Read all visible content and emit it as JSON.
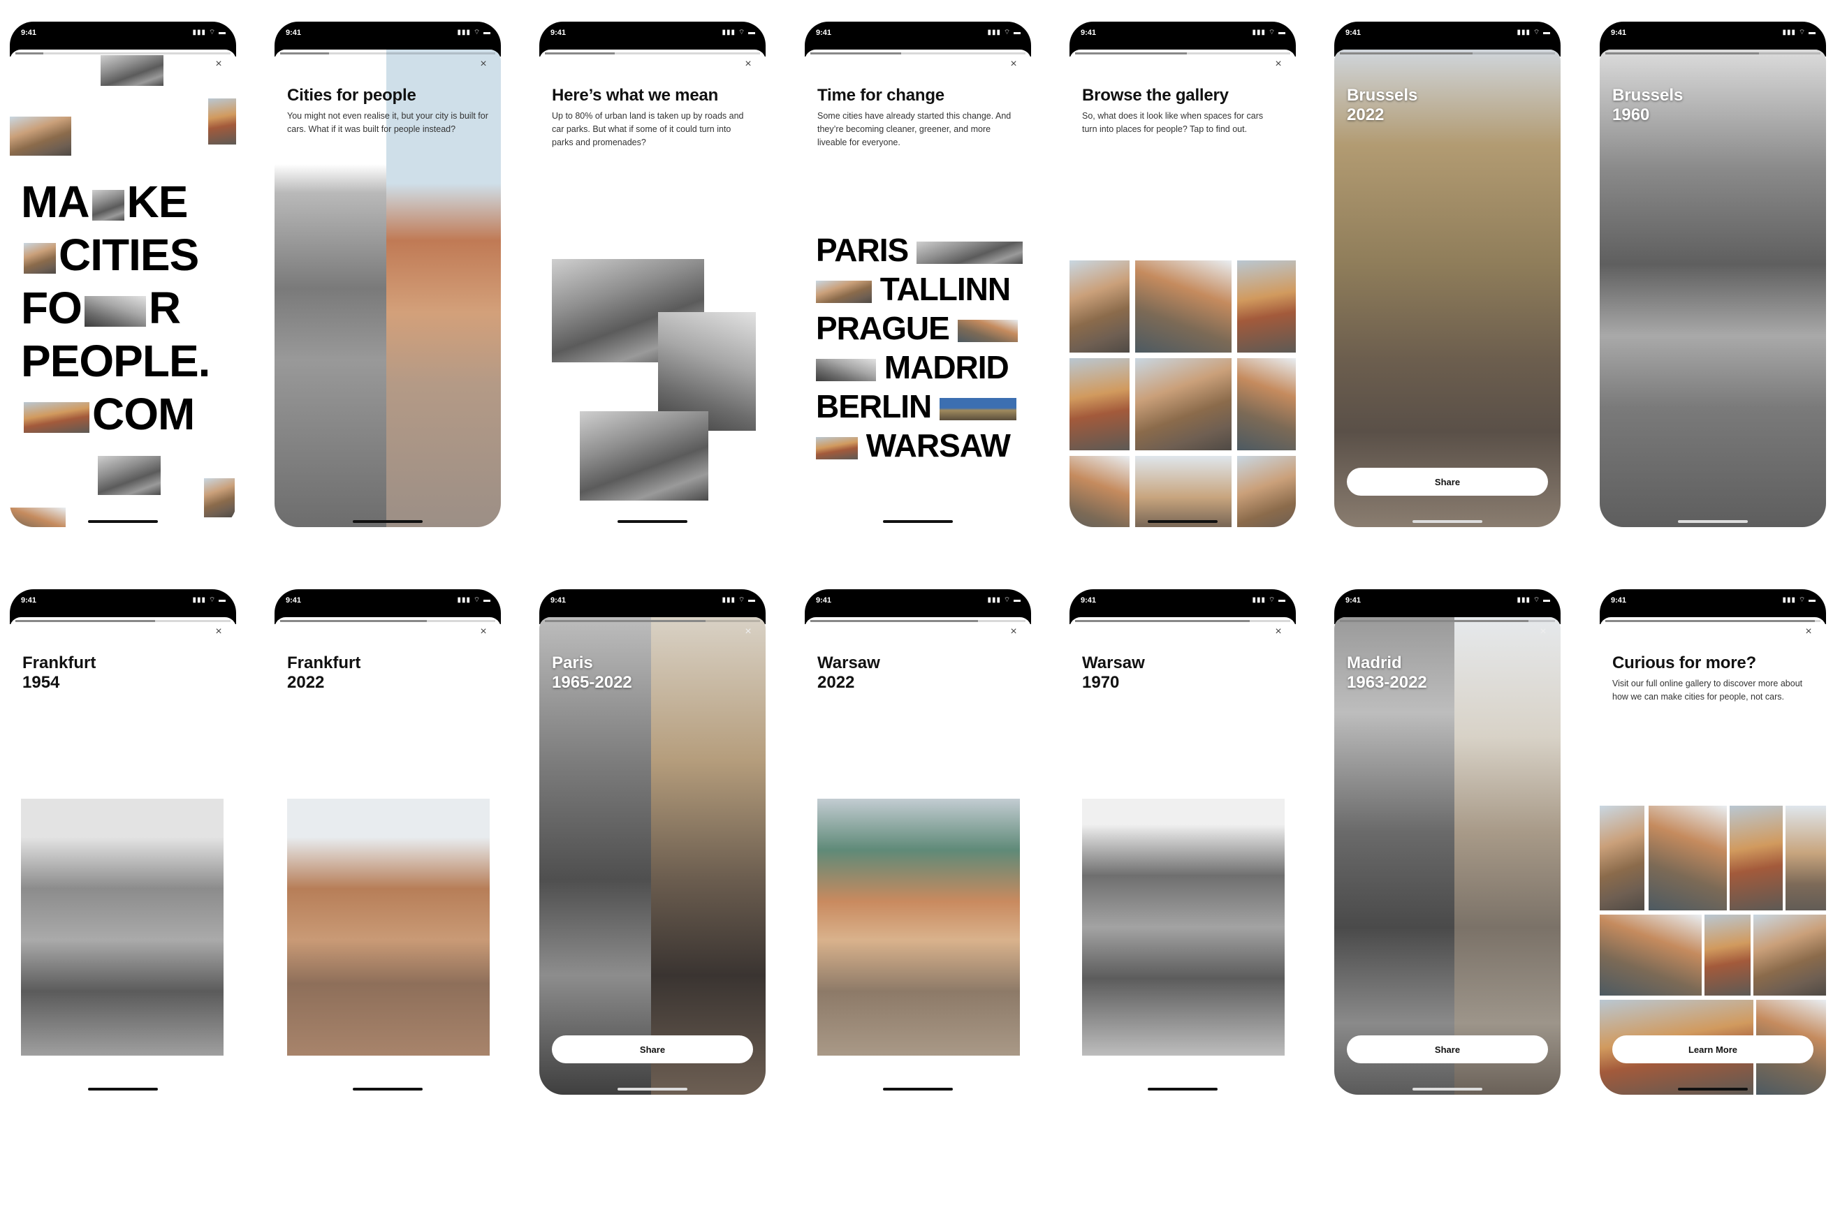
{
  "status_time": "9:41",
  "status_icons": "▮▮▮ ⌔ ▬",
  "close_symbol": "×",
  "screens": {
    "s1": {
      "lines": [
        "MA",
        "KE",
        "CITIES",
        "FO",
        "R",
        "PEOPLE.",
        "COM"
      ]
    },
    "s2": {
      "title": "Cities for people",
      "desc": "You might not even realise it, but your city is built for cars. What if it was built for people instead?"
    },
    "s3": {
      "title": "Here’s what we mean",
      "desc": "Up to 80% of urban land is taken up by roads and car parks. But what if some of it could turn into parks and promenades?"
    },
    "s4": {
      "title": "Time for change",
      "desc": "Some cities have already started this change. And they’re becoming cleaner, greener, and more liveable for everyone.",
      "cities": [
        "PARIS",
        "TALLINN",
        "PRAGUE",
        "MADRID",
        "BERLIN",
        "WARSAW"
      ]
    },
    "s5": {
      "title": "Browse the gallery",
      "desc": "So, what does it look like when spaces for cars turn into places for people? Tap to find out."
    },
    "s6": {
      "city": "Brussels",
      "year": "2022",
      "button": "Share"
    },
    "s7": {
      "city": "Brussels",
      "year": "1960"
    },
    "s8": {
      "city": "Frankfurt",
      "year": "1954"
    },
    "s9": {
      "city": "Frankfurt",
      "year": "2022"
    },
    "s10": {
      "city": "Paris",
      "year": "1965-2022",
      "button": "Share"
    },
    "s11": {
      "city": "Warsaw",
      "year": "2022"
    },
    "s12": {
      "city": "Warsaw",
      "year": "1970"
    },
    "s13": {
      "city": "Madrid",
      "year": "1963-2022",
      "button": "Share"
    },
    "s14": {
      "title": "Curious for more?",
      "desc": "Visit our full online gallery to discover more about how we can make cities for people, not cars.",
      "button": "Learn More"
    }
  }
}
